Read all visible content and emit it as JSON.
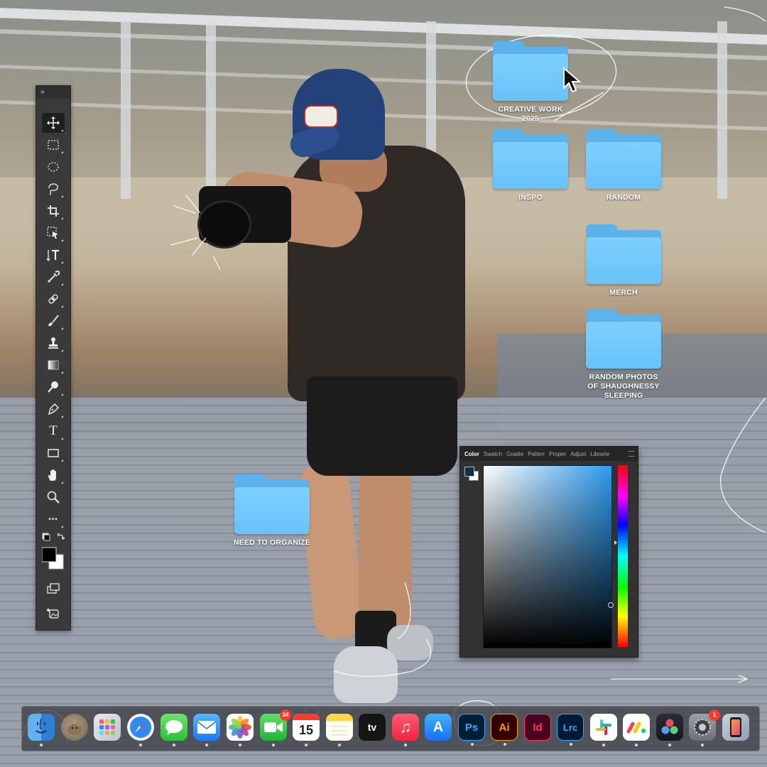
{
  "toolbar": {
    "collapse_glyph": "»",
    "tools": [
      {
        "name": "move-tool",
        "icon": "move-icon"
      },
      {
        "name": "rectangular-marquee-tool",
        "icon": "marquee-rect-icon"
      },
      {
        "name": "elliptical-marquee-tool",
        "icon": "marquee-ellipse-icon"
      },
      {
        "name": "lasso-tool",
        "icon": "lasso-icon"
      },
      {
        "name": "crop-tool",
        "icon": "crop-icon"
      },
      {
        "name": "object-selection-tool",
        "icon": "object-select-icon"
      },
      {
        "name": "vertical-type-tool",
        "icon": "vertical-type-icon"
      },
      {
        "name": "eyedropper-tool",
        "icon": "eyedropper-icon"
      },
      {
        "name": "spot-healing-tool",
        "icon": "bandage-icon"
      },
      {
        "name": "brush-tool",
        "icon": "brush-icon"
      },
      {
        "name": "clone-stamp-tool",
        "icon": "stamp-icon"
      },
      {
        "name": "gradient-tool",
        "icon": "gradient-icon"
      },
      {
        "name": "dodge-tool",
        "icon": "dodge-icon"
      },
      {
        "name": "pen-tool",
        "icon": "pen-icon"
      },
      {
        "name": "type-tool",
        "icon": "type-icon",
        "glyph": "T"
      },
      {
        "name": "rectangle-tool",
        "icon": "rectangle-icon"
      },
      {
        "name": "hand-tool",
        "icon": "hand-icon"
      },
      {
        "name": "zoom-tool",
        "icon": "zoom-icon"
      },
      {
        "name": "more-tools",
        "icon": "ellipsis-icon",
        "glyph": "•••"
      }
    ],
    "foreground_color": "#000000",
    "background_color": "#ffffff"
  },
  "desktop": {
    "folders": [
      {
        "id": "creative",
        "label": "CREATIVE WORK 2025"
      },
      {
        "id": "inspo",
        "label": "INSPO"
      },
      {
        "id": "random",
        "label": "RANDOM"
      },
      {
        "id": "merch",
        "label": "MERCH"
      },
      {
        "id": "sleeping",
        "label": "RANDOM PHOTOS OF SHAUGHNESSY SLEEPING"
      },
      {
        "id": "organize",
        "label": "NEED TO ORGANIZE"
      }
    ],
    "folder_color": "#6ac4fa"
  },
  "color_panel": {
    "tabs": [
      "Color",
      "Swatch",
      "Gradie",
      "Patterr",
      "Proper",
      "Adjust",
      "Librarie"
    ],
    "active_tab": "Color",
    "hue_color": "#2d9aef",
    "foreground": "#0e2f4a",
    "background": "#ffffff"
  },
  "dock": {
    "apps": [
      {
        "name": "finder",
        "label": ""
      },
      {
        "name": "ref-image",
        "label": ""
      },
      {
        "name": "launchpad",
        "label": ""
      },
      {
        "name": "safari",
        "label": ""
      },
      {
        "name": "messages",
        "label": ""
      },
      {
        "name": "mail",
        "label": ""
      },
      {
        "name": "photos",
        "label": ""
      },
      {
        "name": "facetime",
        "label": "",
        "badge": "34"
      },
      {
        "name": "calendar",
        "label": "15"
      },
      {
        "name": "notes",
        "label": ""
      },
      {
        "name": "apple-tv",
        "label": "tv"
      },
      {
        "name": "music",
        "label": "♫"
      },
      {
        "name": "app-store",
        "label": "A"
      },
      {
        "name": "photoshop",
        "label": "Ps"
      },
      {
        "name": "illustrator",
        "label": "Ai"
      },
      {
        "name": "indesign",
        "label": "Id"
      },
      {
        "name": "lightroom-classic",
        "label": "Lrc"
      },
      {
        "name": "slack",
        "label": ""
      },
      {
        "name": "monday",
        "label": ""
      },
      {
        "name": "davinci-resolve",
        "label": ""
      },
      {
        "name": "system-settings",
        "label": "",
        "badge": "1"
      },
      {
        "name": "iphone-mirroring",
        "label": ""
      }
    ]
  }
}
